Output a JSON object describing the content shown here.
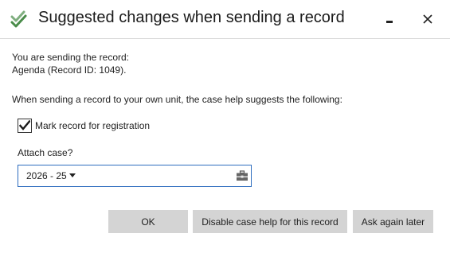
{
  "window": {
    "title": "Suggested changes when sending a record",
    "controls": {
      "minimize_icon": "minimize-icon",
      "close_icon": "close-icon"
    },
    "app_icon": "double-check-icon",
    "colors": {
      "app_icon": "#4a8c4a",
      "focus_border": "#2e6dbf",
      "button_bg": "#d4d4d4"
    }
  },
  "message": {
    "sending_label": "You are sending the record:",
    "record_name": "Agenda (Record ID: 1049).",
    "suggestion_text": "When sending a record to your own unit, the case help suggests the following:"
  },
  "options": {
    "mark_registration": {
      "label": "Mark record for registration",
      "checked": true
    },
    "attach_case": {
      "label": "Attach case?",
      "selected_value": "2026 - 25",
      "icon": "case-folder-icon"
    }
  },
  "buttons": {
    "ok": "OK",
    "disable": "Disable case help for this record",
    "later": "Ask again later"
  }
}
